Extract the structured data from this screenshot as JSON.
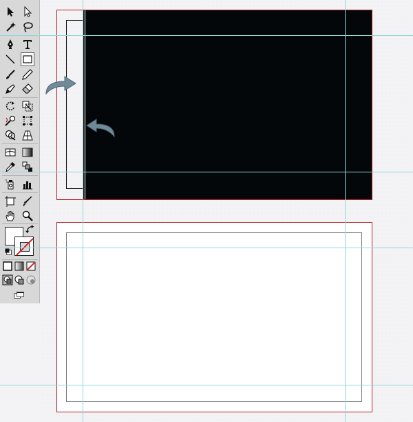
{
  "toolbox": {
    "tools": [
      "selection-tool",
      "direct-selection-tool",
      "magic-wand-tool",
      "lasso-tool",
      "pen-tool",
      "type-tool",
      "line-segment-tool",
      "rectangle-tool",
      "paintbrush-tool",
      "pencil-tool",
      "blob-brush-tool",
      "eraser-tool",
      "rotate-tool",
      "scale-tool",
      "warp-tool",
      "free-transform-tool",
      "shape-builder-tool",
      "perspective-grid-tool",
      "mesh-tool",
      "gradient-tool",
      "eyedropper-tool",
      "blend-tool",
      "symbol-sprayer-tool",
      "column-graph-tool",
      "artboard-tool",
      "slice-tool",
      "hand-tool",
      "zoom-tool"
    ],
    "selected_tool": "rectangle-tool",
    "fill_color": "#ffffff",
    "stroke_color": "none"
  },
  "colors": {
    "bleed": "#b0202a",
    "guide": "#8fd8da",
    "black_fill": "#040709",
    "arrow": "#6f8a98"
  }
}
